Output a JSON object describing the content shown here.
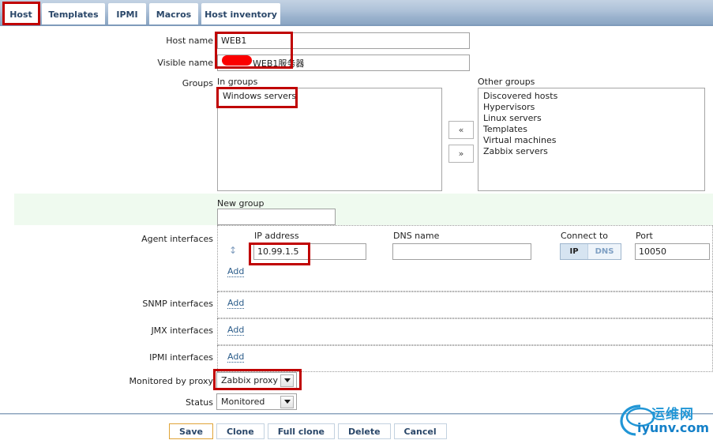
{
  "tabs": [
    {
      "label": "Host",
      "active": true
    },
    {
      "label": "Templates",
      "active": false
    },
    {
      "label": "IPMI",
      "active": false
    },
    {
      "label": "Macros",
      "active": false
    },
    {
      "label": "Host inventory",
      "active": false
    }
  ],
  "fields": {
    "host_name_label": "Host name",
    "host_name_value": "WEB1",
    "visible_name_label": "Visible name",
    "visible_name_value": "WEB1服务器",
    "groups_label": "Groups",
    "in_groups_caption": "In groups",
    "other_groups_caption": "Other groups",
    "new_group_caption": "New group",
    "new_group_value": "",
    "agent_interfaces_label": "Agent interfaces",
    "snmp_interfaces_label": "SNMP interfaces",
    "jmx_interfaces_label": "JMX interfaces",
    "ipmi_interfaces_label": "IPMI interfaces",
    "monitored_by_proxy_label": "Monitored by proxy",
    "status_label": "Status"
  },
  "in_groups": [
    "Windows servers"
  ],
  "other_groups": [
    "Discovered hosts",
    "Hypervisors",
    "Linux servers",
    "Templates",
    "Virtual machines",
    "Zabbix servers"
  ],
  "transfer_buttons": {
    "move_left": "«",
    "move_right": "»"
  },
  "interface_table": {
    "headers": {
      "ip_address": "IP address",
      "dns_name": "DNS name",
      "connect_to": "Connect to",
      "port": "Port"
    },
    "row": {
      "ip_address": "10.99.1.5",
      "dns_name": "",
      "connect_to_ip": "IP",
      "connect_to_dns": "DNS",
      "connect_to_selected": "IP",
      "port": "10050"
    },
    "add_link": "Add"
  },
  "snmp_add_link": "Add",
  "jmx_add_link": "Add",
  "ipmi_add_link": "Add",
  "proxy": {
    "selected": "Zabbix proxy"
  },
  "status": {
    "selected": "Monitored"
  },
  "buttons": [
    {
      "label": "Save",
      "primary": true
    },
    {
      "label": "Clone",
      "primary": false
    },
    {
      "label": "Full clone",
      "primary": false
    },
    {
      "label": "Delete",
      "primary": false
    },
    {
      "label": "Cancel",
      "primary": false
    }
  ],
  "watermark": {
    "zh": "运维网",
    "en": "iyunv.com"
  },
  "colors": {
    "annotation_red": "#c00000",
    "tabbar_blue": "#9ab2cd",
    "new_group_band_green": "#effaef",
    "primary_button_border": "#e0a438",
    "watermark_blue": "#1480c8"
  }
}
